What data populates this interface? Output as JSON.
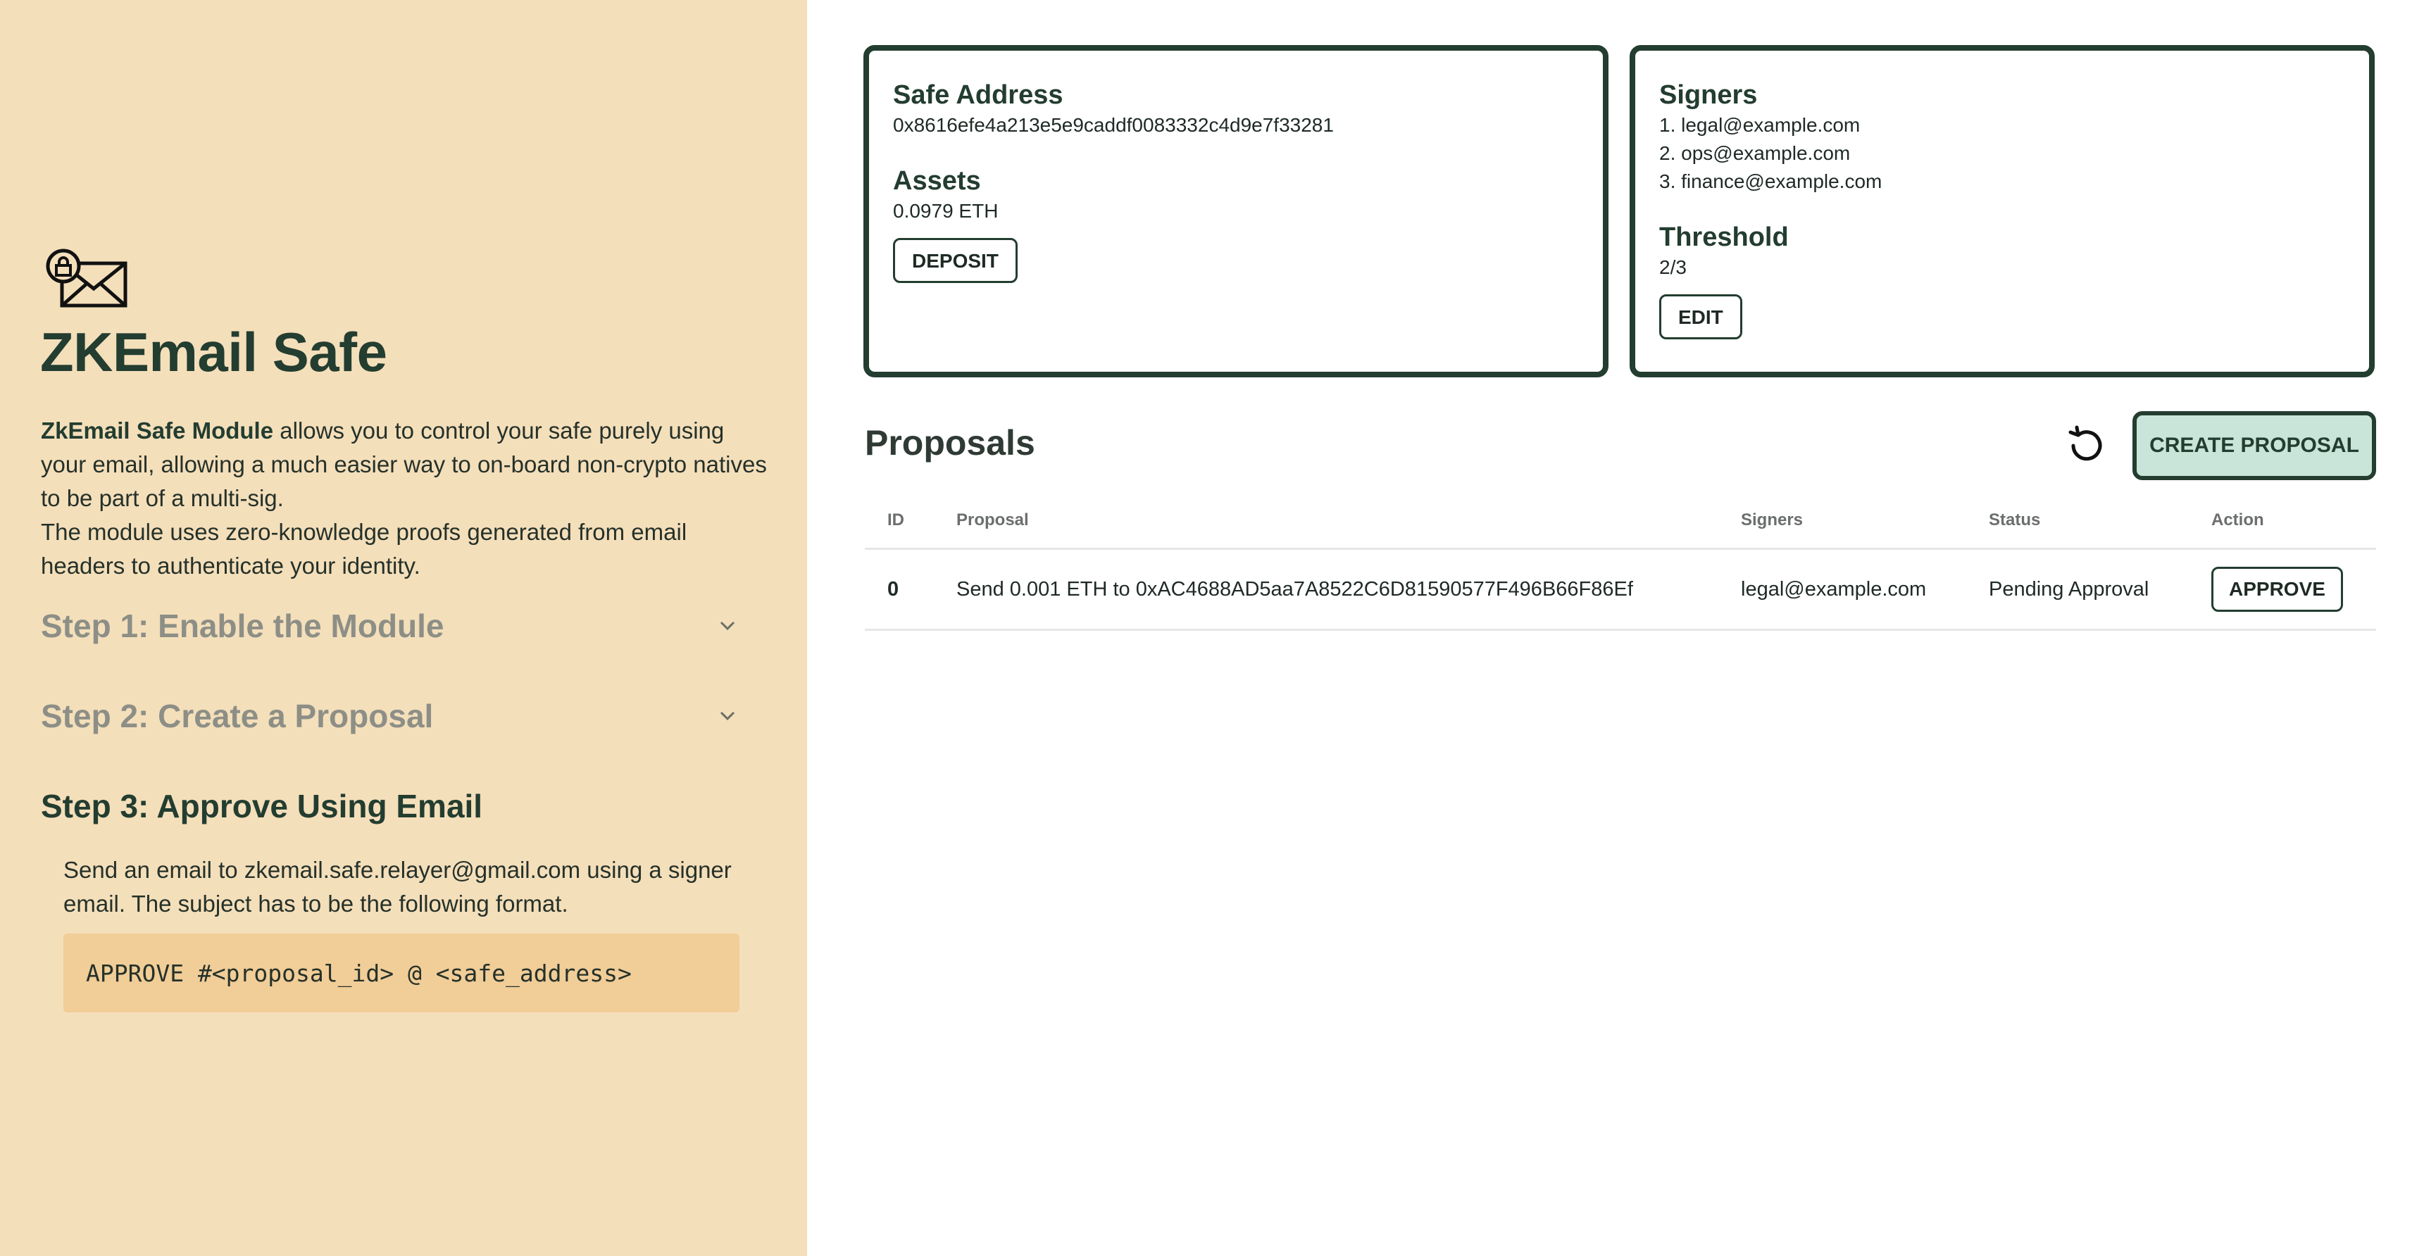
{
  "sidebar": {
    "brand": "ZKEmail Safe",
    "intro_bold": "ZkEmail Safe Module",
    "intro_rest": " allows you to control your safe purely using your email, allowing a much easier way to on-board non-crypto natives to be part of a multi-sig.",
    "intro_line2": "The module uses zero-knowledge proofs generated from email headers to authenticate your identity.",
    "steps": [
      {
        "title": "Step 1: Enable the Module",
        "expanded": false
      },
      {
        "title": "Step 2: Create a Proposal",
        "expanded": false
      },
      {
        "title": "Step 3: Approve Using Email",
        "expanded": true
      }
    ],
    "step3_text": "Send an email to zkemail.safe.relayer@gmail.com using a signer email. The subject has to be the following format.",
    "step3_code": "APPROVE #<proposal_id> @ <safe_address>"
  },
  "safe_card": {
    "address_label": "Safe Address",
    "address": "0x8616efe4a213e5e9caddf0083332c4d9e7f33281",
    "assets_label": "Assets",
    "assets": "0.0979 ETH",
    "deposit_label": "DEPOSIT"
  },
  "signers_card": {
    "signers_label": "Signers",
    "signers": [
      "1. legal@example.com",
      "2. ops@example.com",
      "3. finance@example.com"
    ],
    "threshold_label": "Threshold",
    "threshold": "2/3",
    "edit_label": "EDIT"
  },
  "proposals": {
    "title": "Proposals",
    "create_label": "CREATE PROPOSAL",
    "columns": {
      "id": "ID",
      "proposal": "Proposal",
      "signers": "Signers",
      "status": "Status",
      "action": "Action"
    },
    "rows": [
      {
        "id": "0",
        "proposal": "Send 0.001 ETH to 0xAC4688AD5aa7A8522C6D81590577F496B66F86Ef",
        "signers": "legal@example.com",
        "status": "Pending Approval",
        "action": "APPROVE"
      }
    ]
  },
  "icons": {
    "logo": "locked-envelope-icon",
    "refresh": "refresh-icon",
    "chevron": "chevron-down-icon"
  },
  "colors": {
    "sidebar_bg": "#f4dfbb",
    "accent_dark": "#233d30",
    "code_bg": "#f1cd98",
    "create_btn_bg": "#c9e5d9"
  }
}
